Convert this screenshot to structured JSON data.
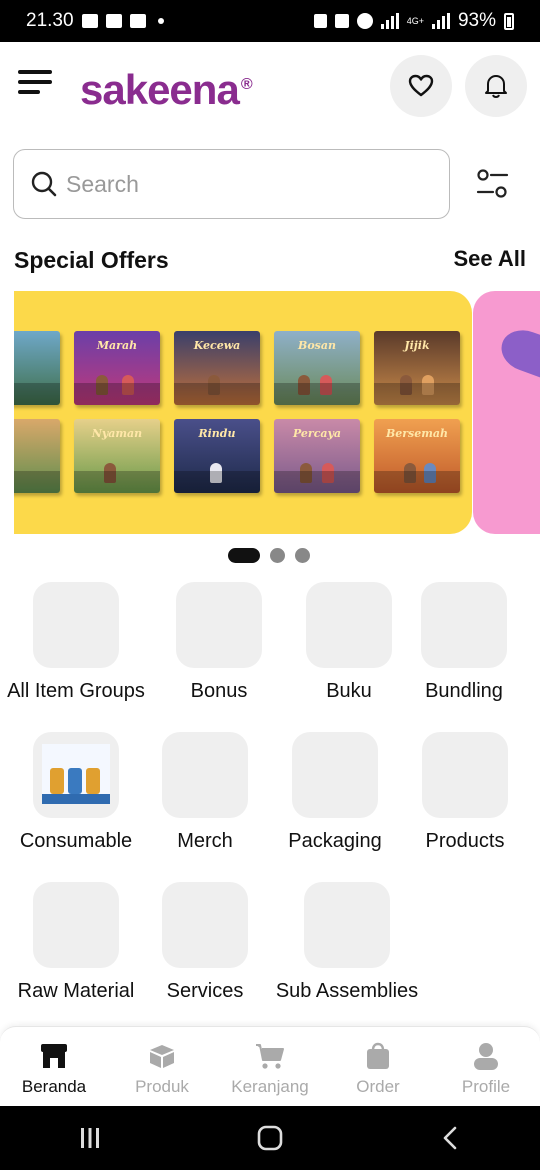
{
  "status_bar": {
    "time": "21.30",
    "network": "4G+",
    "battery": "93%"
  },
  "header": {
    "brand": "sakeena",
    "brand_mark": "®"
  },
  "search": {
    "placeholder": "Search"
  },
  "special_offers": {
    "title": "Special Offers",
    "see_all": "See All",
    "books_row1": [
      "Marah",
      "Kecewa",
      "Bosan",
      "Jijik"
    ],
    "books_row2": [
      "Nyaman",
      "Rindu",
      "Percaya",
      "Bersemah"
    ],
    "slides_total": 3,
    "active_slide": 1
  },
  "categories": [
    {
      "label": "All Item Groups"
    },
    {
      "label": "Bonus"
    },
    {
      "label": "Buku"
    },
    {
      "label": "Bundling"
    },
    {
      "label": "Consumable"
    },
    {
      "label": "Merch"
    },
    {
      "label": "Packaging"
    },
    {
      "label": "Products"
    },
    {
      "label": "Raw Material"
    },
    {
      "label": "Services"
    },
    {
      "label": "Sub Assemblies"
    }
  ],
  "bottom_nav": [
    {
      "label": "Beranda",
      "icon": "store-icon",
      "active": true
    },
    {
      "label": "Produk",
      "icon": "box-icon",
      "active": false
    },
    {
      "label": "Keranjang",
      "icon": "cart-icon",
      "active": false
    },
    {
      "label": "Order",
      "icon": "bag-icon",
      "active": false
    },
    {
      "label": "Profile",
      "icon": "user-icon",
      "active": false
    }
  ],
  "colors": {
    "brand": "#8a2c8f",
    "banner_bg": "#fcd94a",
    "banner2_bg": "#f79ad0",
    "tile_bg": "#efefef",
    "inactive_nav": "#aaaaaa"
  }
}
